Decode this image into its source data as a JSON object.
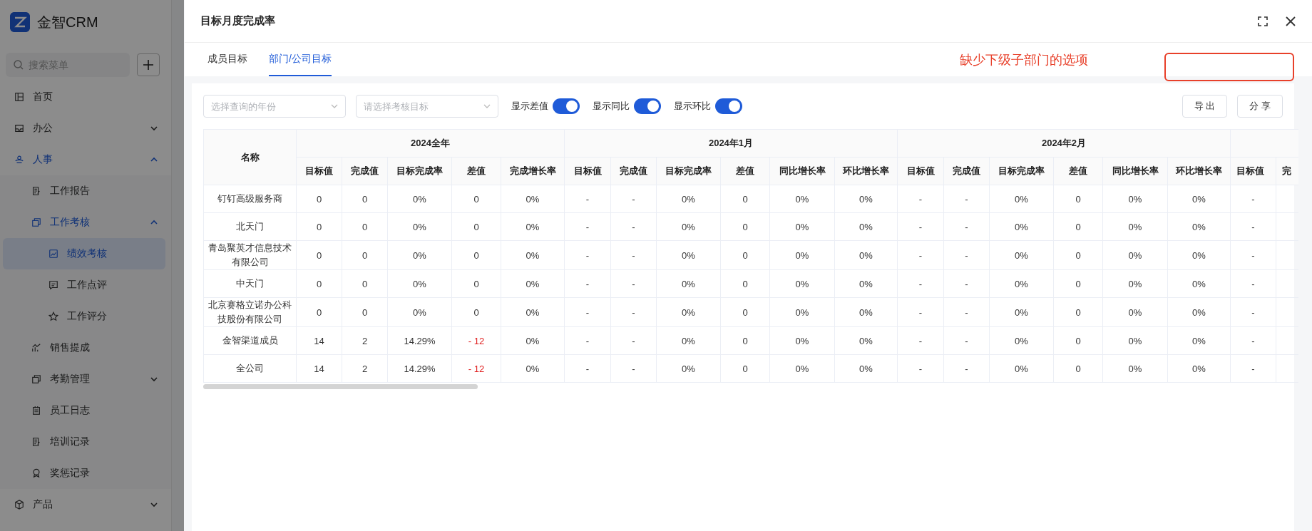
{
  "app": {
    "name": "金智CRM"
  },
  "sidebar": {
    "search_placeholder": "搜索菜单",
    "items": [
      {
        "label": "首页",
        "expanded": false,
        "selected": false
      },
      {
        "label": "办公",
        "expanded": false,
        "selected": false,
        "has_children": true
      },
      {
        "label": "人事",
        "expanded": true,
        "selected": false,
        "has_children": true,
        "children": [
          {
            "label": "工作报告",
            "expanded": false,
            "selected": false
          },
          {
            "label": "工作考核",
            "expanded": true,
            "selected": false,
            "has_children": true,
            "children": [
              {
                "label": "绩效考核",
                "expanded": false,
                "selected": true
              },
              {
                "label": "工作点评",
                "expanded": false,
                "selected": false
              },
              {
                "label": "工作评分",
                "expanded": false,
                "selected": false
              }
            ]
          },
          {
            "label": "销售提成",
            "expanded": false,
            "selected": false
          },
          {
            "label": "考勤管理",
            "expanded": false,
            "selected": false,
            "has_children": true
          },
          {
            "label": "员工日志",
            "expanded": false,
            "selected": false
          },
          {
            "label": "培训记录",
            "expanded": false,
            "selected": false
          },
          {
            "label": "奖惩记录",
            "expanded": false,
            "selected": false
          }
        ]
      },
      {
        "label": "产品",
        "expanded": false,
        "selected": false,
        "has_children": true
      }
    ]
  },
  "drawer": {
    "title": "目标月度完成率",
    "tabs": [
      {
        "label": "成员目标",
        "selected": false
      },
      {
        "label": "部门/公司目标",
        "selected": true
      }
    ],
    "annotation": {
      "text": "缺少下级子部门的选项"
    },
    "filters": [
      {
        "placeholder": "选择查询的年份"
      },
      {
        "placeholder": "请选择考核目标"
      }
    ],
    "toggles": [
      {
        "label": "显示差值",
        "on": true
      },
      {
        "label": "显示同比",
        "on": true
      },
      {
        "label": "显示环比",
        "on": true
      }
    ],
    "buttons": [
      "导 出",
      "分 享"
    ],
    "table": {
      "name_header": "名称",
      "groups": [
        {
          "label": "2024全年",
          "columns": [
            "目标值",
            "完成值",
            "目标完成率",
            "差值",
            "完成增长率"
          ]
        },
        {
          "label": "2024年1月",
          "columns": [
            "目标值",
            "完成值",
            "目标完成率",
            "差值",
            "同比增长率",
            "环比增长率"
          ]
        },
        {
          "label": "2024年2月",
          "columns": [
            "目标值",
            "完成值",
            "目标完成率",
            "差值",
            "同比增长率",
            "环比增长率"
          ]
        },
        {
          "columns": [
            "目标值",
            "完"
          ]
        }
      ],
      "rows": [
        {
          "name": "钉钉高级服务商",
          "negative_diff": false,
          "cells": [
            "0",
            "0",
            "0%",
            "0",
            "0%",
            "-",
            "-",
            "0%",
            "0",
            "0%",
            "0%",
            "-",
            "-",
            "0%",
            "0",
            "0%",
            "0%",
            "-"
          ]
        },
        {
          "name": "北天门",
          "negative_diff": false,
          "cells": [
            "0",
            "0",
            "0%",
            "0",
            "0%",
            "-",
            "-",
            "0%",
            "0",
            "0%",
            "0%",
            "-",
            "-",
            "0%",
            "0",
            "0%",
            "0%",
            "-"
          ]
        },
        {
          "name": "青岛聚英才信息技术有限公司",
          "negative_diff": false,
          "cells": [
            "0",
            "0",
            "0%",
            "0",
            "0%",
            "-",
            "-",
            "0%",
            "0",
            "0%",
            "0%",
            "-",
            "-",
            "0%",
            "0",
            "0%",
            "0%",
            "-"
          ]
        },
        {
          "name": "中天门",
          "negative_diff": false,
          "cells": [
            "0",
            "0",
            "0%",
            "0",
            "0%",
            "-",
            "-",
            "0%",
            "0",
            "0%",
            "0%",
            "-",
            "-",
            "0%",
            "0",
            "0%",
            "0%",
            "-"
          ]
        },
        {
          "name": "北京赛格立诺办公科技股份有限公司",
          "negative_diff": false,
          "cells": [
            "0",
            "0",
            "0%",
            "0",
            "0%",
            "-",
            "-",
            "0%",
            "0",
            "0%",
            "0%",
            "-",
            "-",
            "0%",
            "0",
            "0%",
            "0%",
            "-"
          ]
        },
        {
          "name": "金智渠道成员",
          "negative_diff": true,
          "cells": [
            "14",
            "2",
            "14.29%",
            "- 12",
            "0%",
            "-",
            "-",
            "0%",
            "0",
            "0%",
            "0%",
            "-",
            "-",
            "0%",
            "0",
            "0%",
            "0%",
            "-"
          ]
        },
        {
          "name": "全公司",
          "negative_diff": true,
          "cells": [
            "14",
            "2",
            "14.29%",
            "- 12",
            "0%",
            "-",
            "-",
            "0%",
            "0",
            "0%",
            "0%",
            "-",
            "-",
            "0%",
            "0",
            "0%",
            "0%",
            "-"
          ]
        }
      ]
    }
  }
}
